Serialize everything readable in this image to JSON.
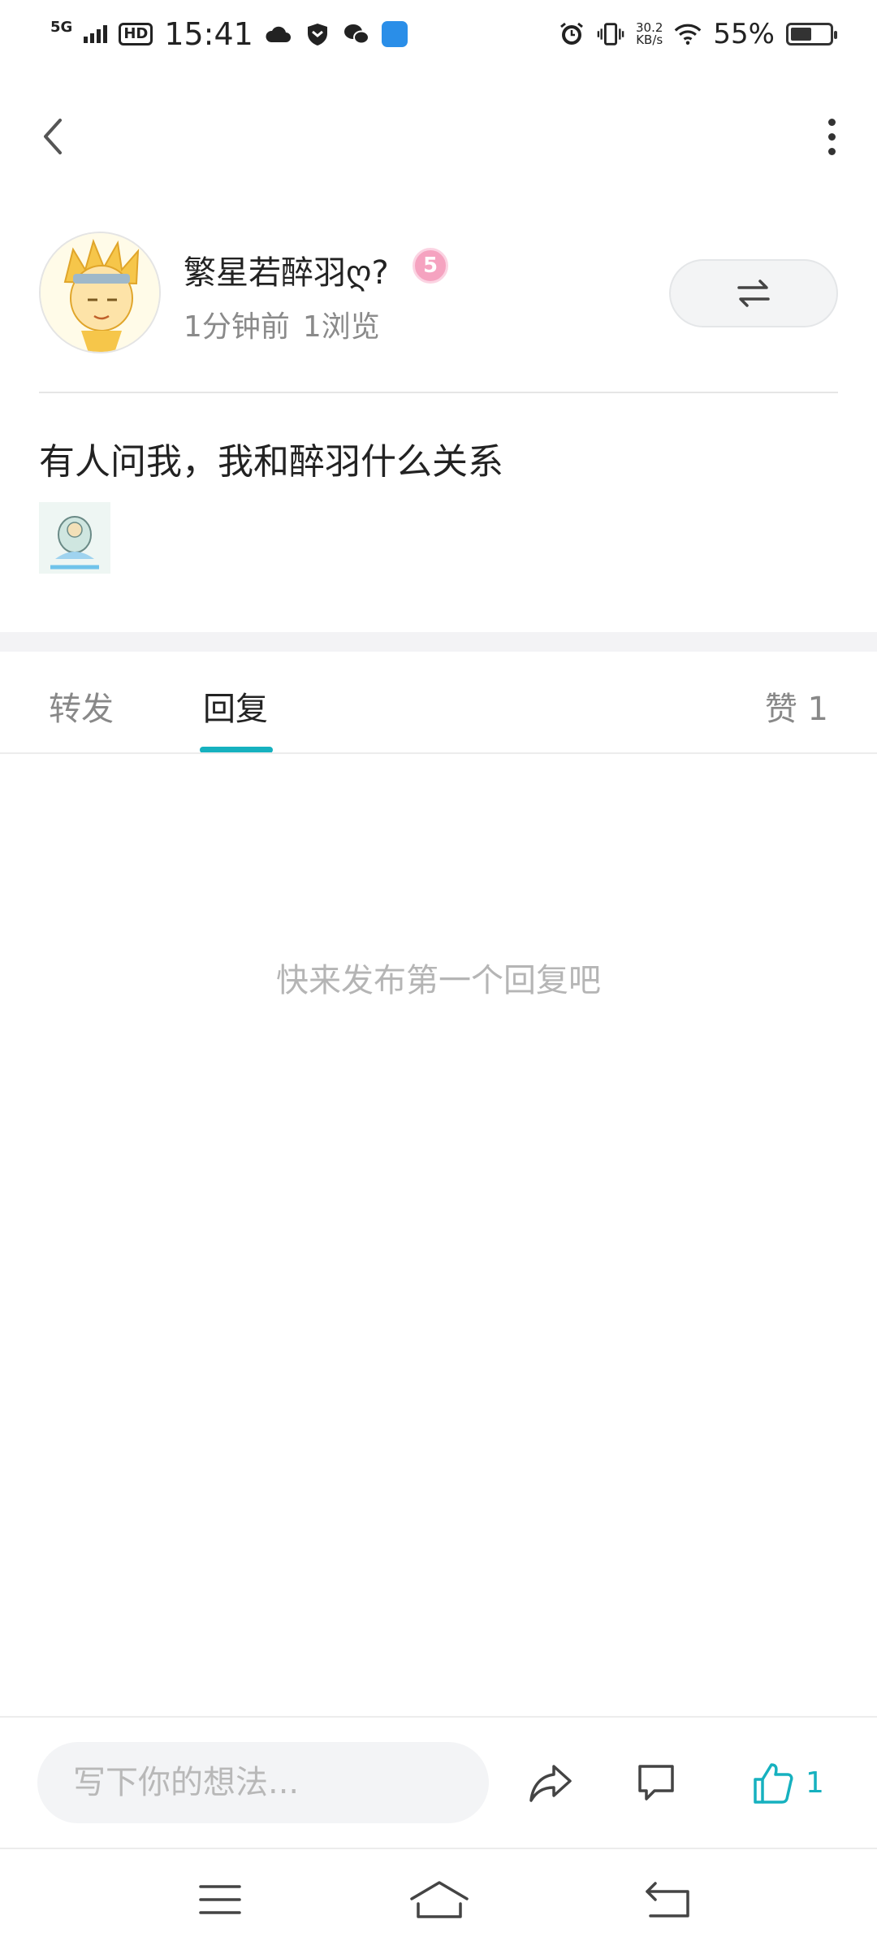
{
  "status_bar": {
    "network": "5G",
    "hd": "HD",
    "time": "15:41",
    "speed_value": "30.2",
    "speed_unit": "KB/s",
    "battery_percent": "55%",
    "battery_level": 0.55
  },
  "header": {
    "back_icon": "chevron-left-icon",
    "more_icon": "more-vertical-icon"
  },
  "author": {
    "name": "繁星若醉羽ღ?",
    "level": "5",
    "time_ago": "1分钟前",
    "views": "1浏览"
  },
  "post": {
    "text": "有人问我，我和醉羽什么关系"
  },
  "tabs": {
    "forward": "转发",
    "reply": "回复",
    "likes": "赞 1",
    "active": "reply"
  },
  "empty_hint": "快来发布第一个回复吧",
  "bottom_bar": {
    "input_placeholder": "写下你的想法...",
    "like_count": "1"
  },
  "colors": {
    "accent": "#16b1bf",
    "level_badge": "#f5a3c0",
    "text_primary": "#222222",
    "text_secondary": "#8a8a8a"
  }
}
